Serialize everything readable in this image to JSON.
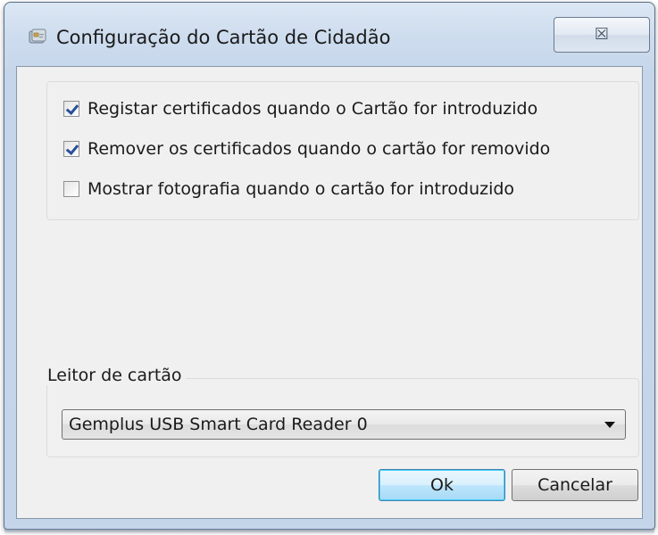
{
  "window": {
    "title": "Configuração do Cartão de Cidadão",
    "close_glyph": "☒",
    "icon": "smart-card-icon"
  },
  "options": [
    {
      "label": "Registar certificados quando o Cartão for introduzido",
      "checked": true
    },
    {
      "label": "Remover os certificados quando o cartão for removido",
      "checked": true
    },
    {
      "label": "Mostrar fotografia quando o cartão for introduzido",
      "checked": false
    }
  ],
  "reader": {
    "legend": "Leitor de cartão",
    "selected": "Gemplus USB Smart Card Reader 0"
  },
  "buttons": {
    "ok": "Ok",
    "cancel": "Cancelar"
  },
  "colors": {
    "accent": "#3c7fb1",
    "check": "#2a4f9a",
    "dialog_bg": "#f0f0f0"
  }
}
